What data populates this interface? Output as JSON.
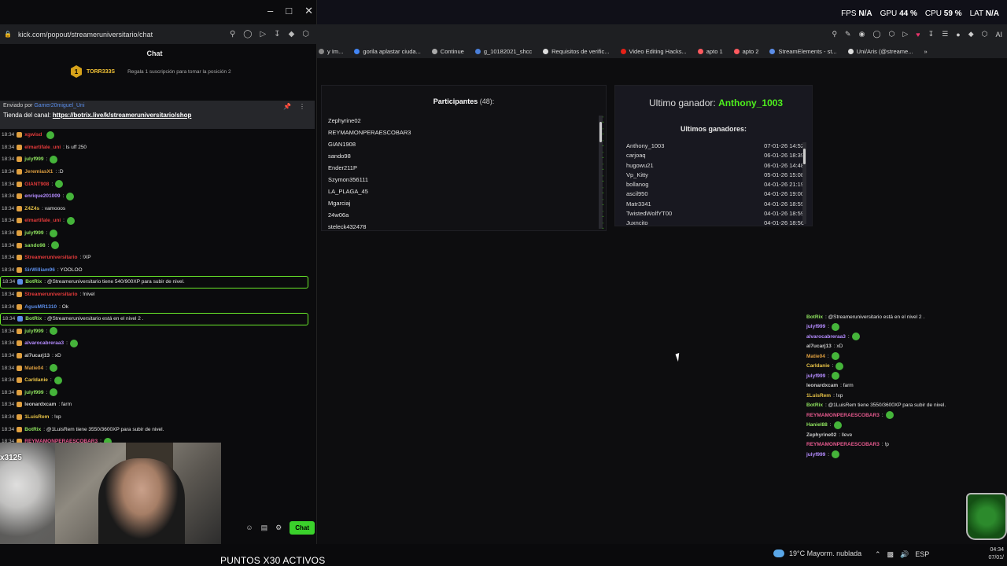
{
  "chat_window": {
    "url": "kick.com/popout/streameruniversitario/chat",
    "title": "Chat",
    "sub_banner": {
      "user": "TORR333S",
      "message": "Regala 1 suscripción para tomar la posición 2"
    },
    "pinned": {
      "by_label": "Enviado por",
      "by_user": "Gamer20miguel_Uni",
      "text": "Tienda del canal:",
      "link": "https://botrix.live/k/streameruniversitario/shop"
    },
    "messages": [
      {
        "time": "18:34",
        "user": "xgwisd",
        "color": "#e63b3b",
        "text": ""
      },
      {
        "time": "18:34",
        "user": "elmartifale_uni",
        "color": "#e63b3b",
        "text": ": ls uff 250"
      },
      {
        "time": "18:34",
        "user": "julyf999",
        "color": "#8fe35f",
        "text": ":"
      },
      {
        "time": "18:34",
        "user": "JeremiasX1",
        "color": "#e0a040",
        "text": ": :D"
      },
      {
        "time": "18:34",
        "user": "GIANT908",
        "color": "#e63b3b",
        "text": ":"
      },
      {
        "time": "18:34",
        "user": "enrique201009",
        "color": "#b58cff",
        "text": ":"
      },
      {
        "time": "18:34",
        "user": "Z4Z4s",
        "color": "#e8c347",
        "text": ": vamooos"
      },
      {
        "time": "18:34",
        "user": "elmartifale_uni",
        "color": "#e63b3b",
        "text": ":"
      },
      {
        "time": "18:34",
        "user": "julyf999",
        "color": "#8fe35f",
        "text": ":"
      },
      {
        "time": "18:34",
        "user": "sando98",
        "color": "#8fe35f",
        "text": ":"
      },
      {
        "time": "18:34",
        "user": "Streameruniversitario",
        "color": "#e63b3b",
        "text": ": !XP"
      },
      {
        "time": "18:34",
        "user": "SirWilliam96",
        "color": "#5b8de8",
        "text": ": YOOLOO"
      },
      {
        "time": "18:34",
        "user": "BotRix",
        "color": "#8fe35f",
        "text": ": @Streameruniversitario tiene 540/900XP para subir de nivel.",
        "highlight": true
      },
      {
        "time": "18:34",
        "user": "Streameruniversitario",
        "color": "#e63b3b",
        "text": ": !nivel"
      },
      {
        "time": "18:34",
        "user": "AgusMR1310",
        "color": "#5b8de8",
        "text": ": Ok"
      },
      {
        "time": "18:34",
        "user": "BotRix",
        "color": "#8fe35f",
        "text": ": @Streameruniversitario está en el nivel 2 .",
        "highlight": true
      },
      {
        "time": "18:34",
        "user": "julyf999",
        "color": "#8fe35f",
        "text": ":"
      },
      {
        "time": "18:34",
        "user": "alvarocabreraa3",
        "color": "#b58cff",
        "text": ":"
      },
      {
        "time": "18:34",
        "user": "al7ucarj13",
        "color": "#cccccc",
        "text": ": xD"
      },
      {
        "time": "18:34",
        "user": "Matie04",
        "color": "#e0a040",
        "text": ":"
      },
      {
        "time": "18:34",
        "user": "Carldanie",
        "color": "#e8c347",
        "text": ":"
      },
      {
        "time": "18:34",
        "user": "julyf999",
        "color": "#8fe35f",
        "text": ":"
      },
      {
        "time": "18:34",
        "user": "leonardxcam",
        "color": "#cccccc",
        "text": ": farm"
      },
      {
        "time": "18:34",
        "user": "1LuisRem",
        "color": "#e8c347",
        "text": ": !xp"
      },
      {
        "time": "18:34",
        "user": "BotRix",
        "color": "#8fe35f",
        "text": ": @1LuisRem tiene 3550/3600XP para subir de nivel."
      },
      {
        "time": "18:34",
        "user": "REYMAMONPERAESCOBAR3",
        "color": "#e85a8f",
        "text": ":"
      }
    ],
    "send_label": "Chat",
    "webcam_counter": "x3125"
  },
  "browser": {
    "stats": [
      {
        "label": "FPS",
        "value": "N/A"
      },
      {
        "label": "GPU",
        "value": "44 %"
      },
      {
        "label": "CPU",
        "value": "59 %"
      },
      {
        "label": "LAT",
        "value": "N/A"
      }
    ],
    "bookmarks": [
      {
        "label": "y Im...",
        "color": "#888"
      },
      {
        "label": "gorila aplastar ciuda...",
        "color": "#4285f4"
      },
      {
        "label": "Continue",
        "color": "#aaa"
      },
      {
        "label": "g_10182021_shcc",
        "color": "#4a7fd9"
      },
      {
        "label": "Requisitos de verific...",
        "color": "#ddd"
      },
      {
        "label": "Video Editing Hacks...",
        "color": "#e62117"
      },
      {
        "label": "apto 1",
        "color": "#ff5a5f"
      },
      {
        "label": "apto 2",
        "color": "#ff5a5f"
      },
      {
        "label": "StreamElements - st...",
        "color": "#5b8de8"
      },
      {
        "label": "Uni/Aris (@streame...",
        "color": "#ddd"
      }
    ],
    "participants": {
      "title": "Participantes",
      "count": "(48):",
      "list": [
        "Zephyrine02",
        "REYMAMONPERAESCOBAR3",
        "GIAN1908",
        "sando98",
        "Ender211P",
        "Szymon356111",
        "LA_PLAGA_45",
        "Mgarciaj",
        "24w06a",
        "steleck432478"
      ]
    },
    "winners": {
      "last_label": "Ultimo ganador:",
      "last_winner": "Anthony_1003",
      "list_title": "Ultimos ganadores:",
      "list": [
        {
          "name": "Anthony_1003",
          "date": "07-01-26 14:52"
        },
        {
          "name": "carjoaq",
          "date": "06-01-26 18:39"
        },
        {
          "name": "hugowu21",
          "date": "06-01-26 14:48"
        },
        {
          "name": "Vp_Kitty",
          "date": "05-01-26 15:08"
        },
        {
          "name": "bollanog",
          "date": "04-01-26 21:19"
        },
        {
          "name": "ascil950",
          "date": "04-01-26 19:00"
        },
        {
          "name": "Matr3341",
          "date": "04-01-26 18:59"
        },
        {
          "name": "TwistedWolfYT00",
          "date": "04-01-26 18:59"
        },
        {
          "name": "Juxncito",
          "date": "04-01-26 18:56"
        }
      ]
    },
    "overlay_chat": [
      {
        "user": "BotRix",
        "color": "#8fe35f",
        "text": ": @Streameruniversitario está en el nivel 2 ."
      },
      {
        "user": "julyf999",
        "color": "#b58cff",
        "text": ":"
      },
      {
        "user": "alvarocabreraa3",
        "color": "#b58cff",
        "text": ":"
      },
      {
        "user": "al7ucarj13",
        "color": "#cccccc",
        "text": ": xD"
      },
      {
        "user": "Matie04",
        "color": "#e0a040",
        "text": ":"
      },
      {
        "user": "Carldanie",
        "color": "#e8c347",
        "text": ":"
      },
      {
        "user": "julyf999",
        "color": "#b58cff",
        "text": ":"
      },
      {
        "user": "leonardxcam",
        "color": "#cccccc",
        "text": ": farm"
      },
      {
        "user": "1LuisRem",
        "color": "#e8c347",
        "text": ": !xp"
      },
      {
        "user": "BotRix",
        "color": "#8fe35f",
        "text": ": @1LuisRem tiene 3550/3600XP para subir de nivel."
      },
      {
        "user": "REYMAMONPERAESCOBAR3",
        "color": "#e85a8f",
        "text": ":"
      },
      {
        "user": "Haniel88",
        "color": "#8fe35f",
        "text": ":"
      },
      {
        "user": "Zephyrine02",
        "color": "#cccccc",
        "text": ": lleve"
      },
      {
        "user": "REYMAMONPERAESCOBAR3",
        "color": "#e85a8f",
        "text": ": !p"
      },
      {
        "user": "julyf999",
        "color": "#b58cff",
        "text": ":"
      }
    ]
  },
  "taskbar": {
    "banner": "PUNTOS X30 ACTIVOS",
    "weather": "19°C  Mayorm. nublada",
    "lang": "ESP",
    "time": "04:34",
    "date": "07/01/"
  }
}
